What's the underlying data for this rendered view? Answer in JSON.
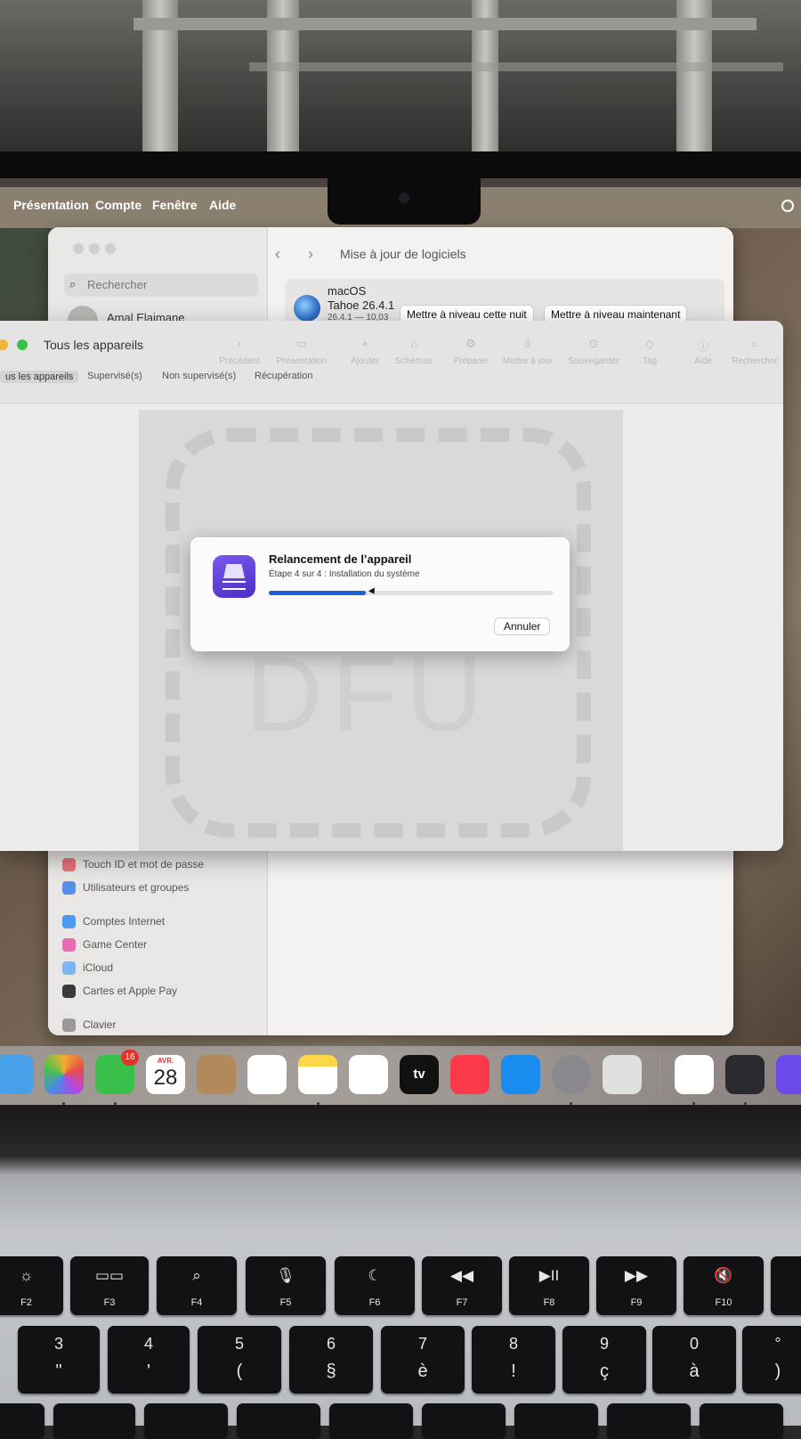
{
  "menubar": {
    "items": [
      "Présentation",
      "Compte",
      "Fenêtre",
      "Aide"
    ]
  },
  "settings": {
    "search_placeholder": "Rechercher",
    "user_name": "Amal Elaimane",
    "back": "‹",
    "forward": "›",
    "title": "Mise à jour de logiciels",
    "update": {
      "os": "macOS",
      "name": "Tahoe 26.4.1",
      "detail": "26.4.1 — 10,03",
      "btn_tonight": "Mettre à niveau cette nuit",
      "btn_now": "Mettre à niveau maintenant"
    },
    "sidebar": [
      {
        "label": "Touch ID et mot de passe",
        "color": "#e8717b"
      },
      {
        "label": "Utilisateurs et groupes",
        "color": "#5a8ee8"
      },
      {
        "label": "Comptes Internet",
        "color": "#4a9af0"
      },
      {
        "label": "Game Center",
        "color": "#e86ab0"
      },
      {
        "label": "iCloud",
        "color": "#7ab6f2"
      },
      {
        "label": "Cartes et Apple Pay",
        "color": "#3a3a3a"
      },
      {
        "label": "Clavier",
        "color": "#9a9a9a"
      }
    ]
  },
  "configurator": {
    "title": "Tous les appareils",
    "toolbar": [
      {
        "icon": "‹",
        "label": "Précédent"
      },
      {
        "icon": "▭",
        "label": "Présentation"
      },
      {
        "icon": "+",
        "label": "Ajouter"
      },
      {
        "icon": "⌂",
        "label": "Schémas"
      },
      {
        "icon": "⚙",
        "label": "Préparer"
      },
      {
        "icon": "⇩",
        "label": "Mettre à jour"
      },
      {
        "icon": "⊙",
        "label": "Sauvegarder"
      },
      {
        "icon": "◇",
        "label": "Tag"
      },
      {
        "icon": "ⓘ",
        "label": "Aide"
      },
      {
        "icon": "⌕",
        "label": "Rechercher"
      }
    ],
    "segments": [
      "us les appareils",
      "Supervisé(s)",
      "Non supervisé(s)",
      "Récupération"
    ],
    "ghost_text": "DFU"
  },
  "dialog": {
    "title": "Relancement de l’appareil",
    "subtitle": "Étape 4 sur 4 : Installation du système",
    "progress_percent": 34,
    "cancel": "Annuler"
  },
  "dock": {
    "facetime_badge": "16",
    "calendar_month": "AVR.",
    "calendar_day": "28",
    "tv_label": "tv",
    "colors": {
      "maps": "#4aa0e8",
      "photos": "#f0b030",
      "facetime": "#38c04a",
      "contacts": "#b08a5a",
      "reminders": "#ffffff",
      "notes": "#ffd84a",
      "freeform": "#ffffff",
      "music": "#fa3a4a",
      "appstore": "#1a8cf0",
      "settings": "#8a8a8e",
      "iphone": "#e0e0e0",
      "keychain": "#ffffff",
      "quicktime": "#2a2a2e",
      "configurator": "#6a4ae8"
    }
  },
  "keyboard": {
    "fkeys": [
      {
        "icon": "☼",
        "label": "F2"
      },
      {
        "icon": "▭▭",
        "label": "F3"
      },
      {
        "icon": "⌕",
        "label": "F4"
      },
      {
        "icon": "🎙",
        "label": "F5"
      },
      {
        "icon": "☾",
        "label": "F6"
      },
      {
        "icon": "◀◀",
        "label": "F7"
      },
      {
        "icon": "▶II",
        "label": "F8"
      },
      {
        "icon": "▶▶",
        "label": "F9"
      },
      {
        "icon": "🔇",
        "label": "F10"
      }
    ],
    "numkeys": [
      {
        "top": "3",
        "bottom": "\""
      },
      {
        "top": "4",
        "bottom": "'"
      },
      {
        "top": "5",
        "bottom": "("
      },
      {
        "top": "6",
        "bottom": "§"
      },
      {
        "top": "7",
        "bottom": "è"
      },
      {
        "top": "8",
        "bottom": "!"
      },
      {
        "top": "9",
        "bottom": "ç"
      },
      {
        "top": "0",
        "bottom": "à"
      },
      {
        "top": "°",
        "bottom": ")"
      }
    ]
  }
}
